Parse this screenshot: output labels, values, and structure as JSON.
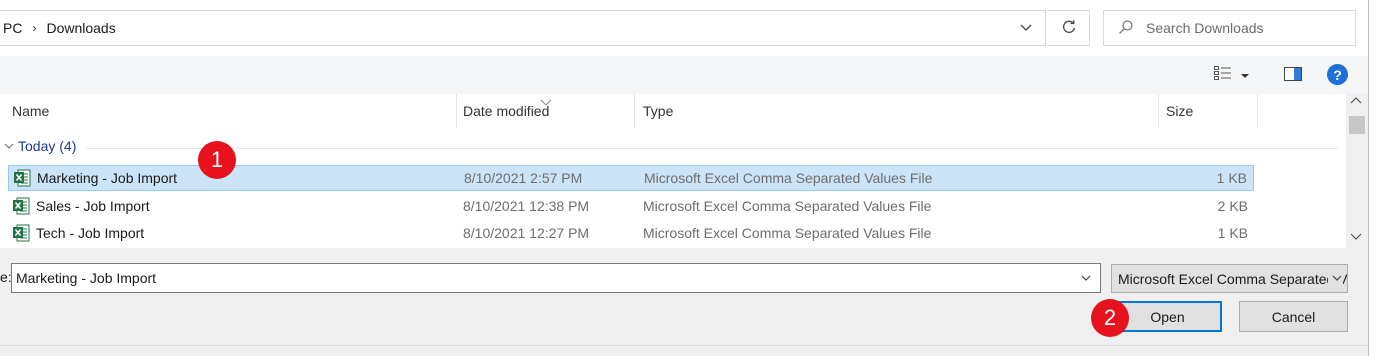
{
  "address": {
    "breadcrumb": [
      "PC",
      "Downloads"
    ],
    "separator": "›"
  },
  "search": {
    "placeholder": "Search Downloads"
  },
  "toolbar": {
    "help_label": "?"
  },
  "columns": {
    "name": "Name",
    "date": "Date modified",
    "type": "Type",
    "size": "Size"
  },
  "group": {
    "label": "Today (4)"
  },
  "files": [
    {
      "name": "Marketing - Job Import",
      "date": "8/10/2021 2:57 PM",
      "type": "Microsoft Excel Comma Separated Values File",
      "size": "1 KB",
      "selected": true
    },
    {
      "name": "Sales - Job Import",
      "date": "8/10/2021 12:38 PM",
      "type": "Microsoft Excel Comma Separated Values File",
      "size": "2 KB",
      "selected": false
    },
    {
      "name": "Tech - Job Import",
      "date": "8/10/2021 12:27 PM",
      "type": "Microsoft Excel Comma Separated Values File",
      "size": "1 KB",
      "selected": false
    }
  ],
  "bottom": {
    "filename_label": "e:",
    "filename_value": "Marketing - Job Import",
    "filetype_value": "Microsoft Excel Comma Separated Values File",
    "open_label": "Open",
    "cancel_label": "Cancel"
  },
  "callouts": {
    "one": "1",
    "two": "2"
  },
  "colors": {
    "accent": "#0078d7",
    "selection": "#cce4f7",
    "callout": "#e8121e",
    "group_text": "#1e3a8a"
  }
}
